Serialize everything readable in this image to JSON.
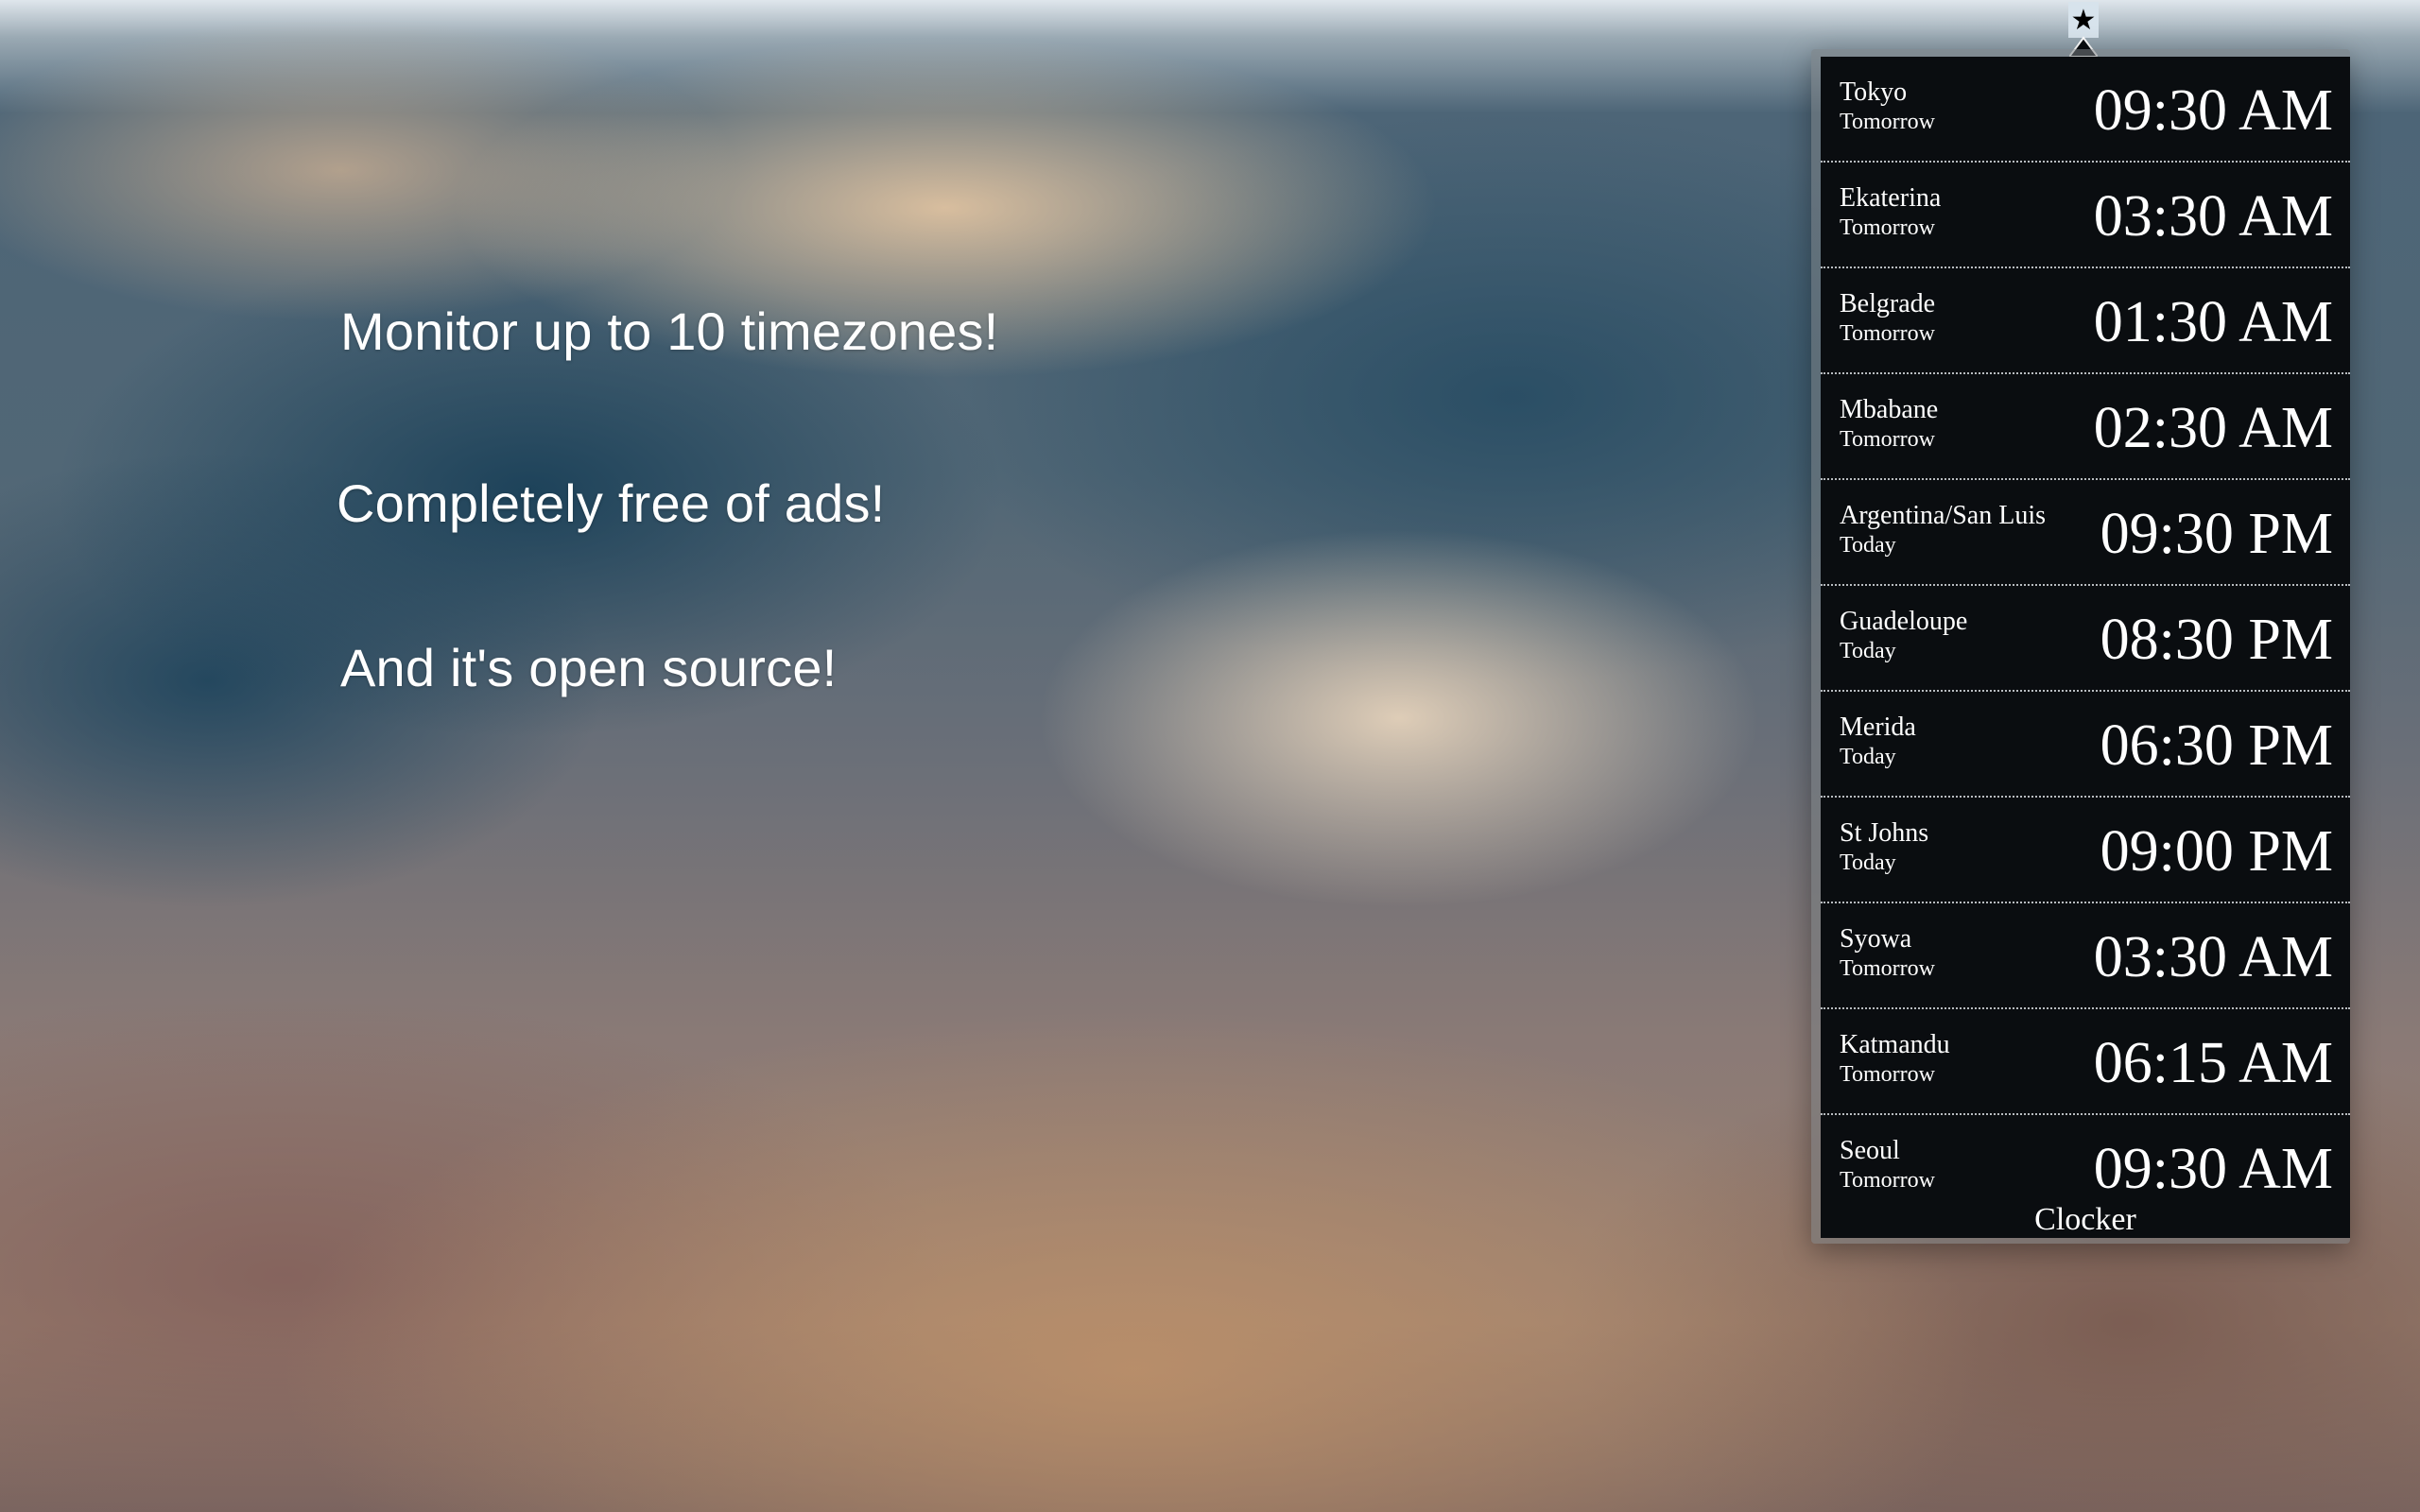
{
  "promo": {
    "line1": "Monitor up to 10 timezones!",
    "line2": "Completely free of ads!",
    "line3": "And it's open source!"
  },
  "menubar": {
    "icon_glyph": "★",
    "icon_name": "star-icon"
  },
  "clocker": {
    "rows": [
      {
        "city": "Tokyo",
        "day": "Tomorrow",
        "time": "09:30 AM"
      },
      {
        "city": "Ekaterina",
        "day": "Tomorrow",
        "time": "03:30 AM"
      },
      {
        "city": "Belgrade",
        "day": "Tomorrow",
        "time": "01:30 AM"
      },
      {
        "city": "Mbabane",
        "day": "Tomorrow",
        "time": "02:30 AM"
      },
      {
        "city": "Argentina/San Luis",
        "day": "Today",
        "time": "09:30 PM"
      },
      {
        "city": "Guadeloupe",
        "day": "Today",
        "time": "08:30 PM"
      },
      {
        "city": "Merida",
        "day": "Today",
        "time": "06:30 PM"
      },
      {
        "city": "St Johns",
        "day": "Today",
        "time": "09:00 PM"
      },
      {
        "city": "Syowa",
        "day": "Tomorrow",
        "time": "03:30 AM"
      },
      {
        "city": "Katmandu",
        "day": "Tomorrow",
        "time": "06:15 AM"
      },
      {
        "city": "Seoul",
        "day": "Tomorrow",
        "time": "09:30 AM"
      }
    ],
    "footer_label": "Clocker"
  }
}
